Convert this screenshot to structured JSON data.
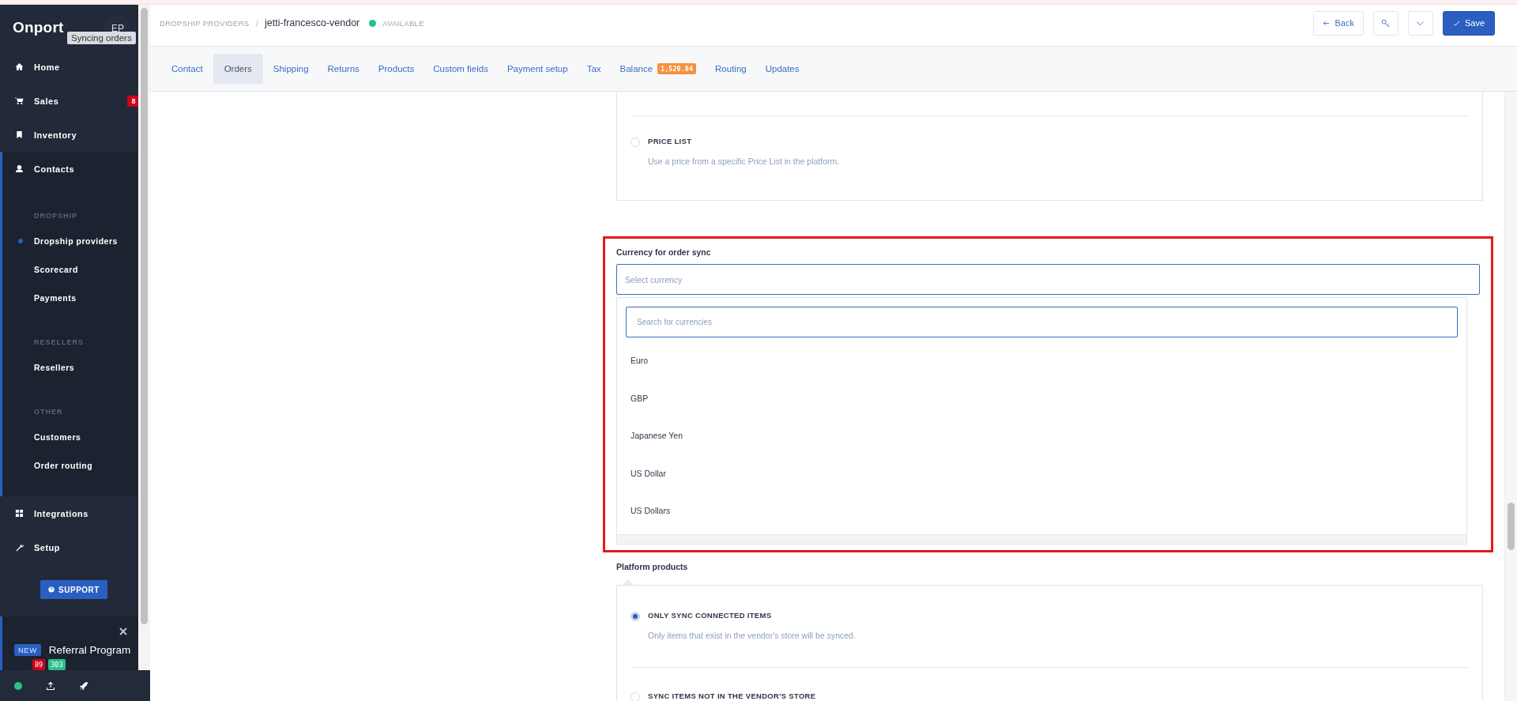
{
  "sidebar": {
    "logo": "Onport",
    "avatar": "EP",
    "tooltip": "Syncing orders",
    "nav": [
      {
        "kind": "item",
        "label": "Home",
        "selected": false
      },
      {
        "kind": "item",
        "label": "Sales",
        "badge": "8",
        "selected": false
      },
      {
        "kind": "item",
        "label": "Inventory",
        "selected": false
      },
      {
        "kind": "group",
        "label": "Contacts",
        "selected": true,
        "expanded": true,
        "children": [
          {
            "kind": "heading",
            "label": "DROPSHIP"
          },
          {
            "kind": "link",
            "label": "Dropship providers",
            "selected": true
          },
          {
            "kind": "link",
            "label": "Scorecard",
            "selected": false
          },
          {
            "kind": "link",
            "label": "Payments",
            "selected": false
          },
          {
            "kind": "heading",
            "label": "RESELLERS"
          },
          {
            "kind": "link",
            "label": "Resellers",
            "selected": false
          },
          {
            "kind": "heading",
            "label": "OTHER"
          },
          {
            "kind": "link",
            "label": "Customers",
            "selected": false
          },
          {
            "kind": "link",
            "label": "Order routing",
            "selected": false
          }
        ]
      },
      {
        "kind": "item",
        "label": "Integrations",
        "selected": false
      },
      {
        "kind": "item",
        "label": "Setup",
        "selected": false
      }
    ],
    "support": "SUPPORT",
    "referral": {
      "badge": "NEW",
      "label": "Referral Program"
    },
    "status": {
      "connected": true,
      "counts": [
        {
          "label": "89",
          "color": "#d0021b"
        },
        {
          "label": "303",
          "color": "#2bbf8a"
        }
      ]
    }
  },
  "header": {
    "breadcrumb": {
      "parent": "DROPSHIP PROVIDERS",
      "separator": "/",
      "current": "jetti-francesco-vendor",
      "status": "AVAILABLE"
    },
    "actions": [
      {
        "kind": "back",
        "label": "Back"
      },
      {
        "kind": "key"
      },
      {
        "kind": "more"
      },
      {
        "kind": "save",
        "label": "Save"
      }
    ]
  },
  "tabs": [
    {
      "label": "Contact",
      "selected": false
    },
    {
      "label": "Orders",
      "selected": true
    },
    {
      "label": "Shipping",
      "selected": false
    },
    {
      "label": "Returns",
      "selected": false
    },
    {
      "label": "Products",
      "selected": false
    },
    {
      "label": "Custom fields",
      "selected": false
    },
    {
      "label": "Payment setup",
      "selected": false
    },
    {
      "label": "Tax",
      "selected": false
    },
    {
      "label": "Balance",
      "badge": "1,520.84",
      "selected": false
    },
    {
      "label": "Routing",
      "selected": false
    },
    {
      "label": "Updates",
      "selected": false
    }
  ],
  "price_option": {
    "label": "PRICE LIST",
    "description": "Use a price from a specific Price List in the platform.",
    "selected": false
  },
  "currency": {
    "label": "Currency for order sync",
    "placeholder": "Select currency",
    "highlighted": true,
    "search_placeholder": "Search for currencies",
    "options": [
      "Euro",
      "GBP",
      "Japanese Yen",
      "US Dollar",
      "US Dollars"
    ]
  },
  "platform_products": {
    "label": "Platform products",
    "options": [
      {
        "label": "ONLY SYNC CONNECTED ITEMS",
        "description": "Only items that exist in the vendor's store will be synced.",
        "selected": true
      },
      {
        "label": "SYNC ITEMS NOT IN THE VENDOR'S STORE",
        "selected": false
      }
    ]
  }
}
